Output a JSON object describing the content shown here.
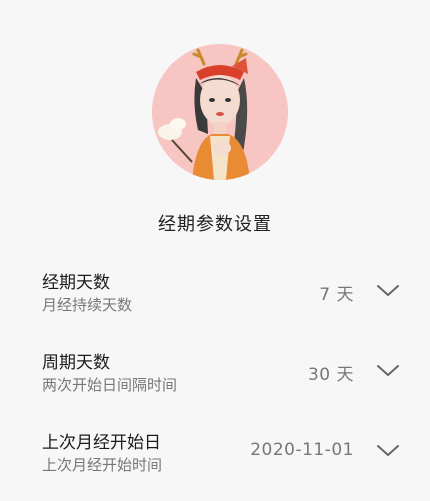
{
  "page": {
    "title": "经期参数设置"
  },
  "settings": [
    {
      "title": "经期天数",
      "subtitle": "月经持续天数",
      "value": "7 天"
    },
    {
      "title": "周期天数",
      "subtitle": "两次开始日间隔时间",
      "value": "30 天"
    },
    {
      "title": "上次月经开始日",
      "subtitle": "上次月经开始时间",
      "value": "2020-11-01"
    }
  ],
  "icons": {
    "dropdown": "chevron-down-icon"
  },
  "colors": {
    "background": "#f7f7f7",
    "avatar_background": "#f7c6c3",
    "title_text": "#1a1a1a",
    "secondary_text": "#777777"
  }
}
